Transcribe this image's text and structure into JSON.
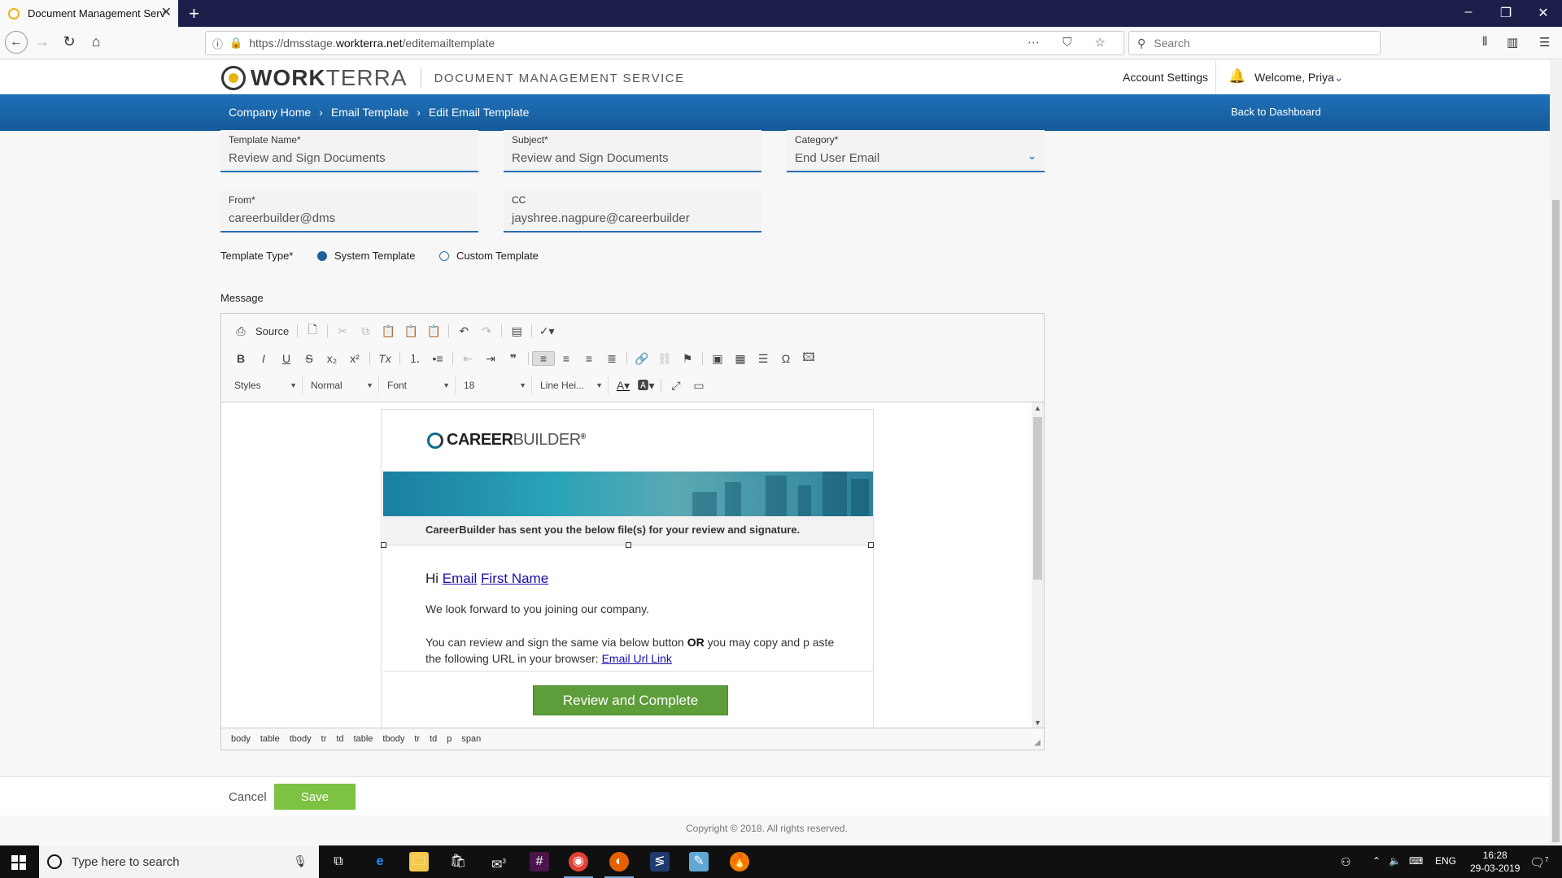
{
  "browser": {
    "tab_title": "Document Management Servic",
    "url_prefix": "https://dmsstage.",
    "url_host": "workterra.net",
    "url_path": "/editemailtemplate",
    "search_placeholder": "Search"
  },
  "header": {
    "brand_bold": "WORK",
    "brand_light": "TERRA",
    "service": "DOCUMENT MANAGEMENT SERVICE",
    "account_settings": "Account Settings",
    "welcome": "Welcome, Priya"
  },
  "breadcrumb": {
    "items": [
      "Company Home",
      "Email Template",
      "Edit Email Template"
    ],
    "back": "Back to Dashboard"
  },
  "form": {
    "template_name": {
      "label": "Template Name*",
      "value": "Review and Sign Documents"
    },
    "subject": {
      "label": "Subject*",
      "value": "Review and Sign Documents"
    },
    "category": {
      "label": "Category*",
      "value": "End User Email"
    },
    "from": {
      "label": "From*",
      "value": "careerbuilder@dms"
    },
    "cc": {
      "label": "CC",
      "value": "jayshree.nagpure@careerbuilder"
    },
    "template_type": {
      "label": "Template Type*",
      "options": [
        "System Template",
        "Custom Template"
      ],
      "selected": "System Template"
    },
    "message_label": "Message"
  },
  "editor": {
    "source_label": "Source",
    "combos": {
      "styles": "Styles",
      "format": "Normal",
      "font": "Font",
      "size": "18",
      "line_height": "Line Hei..."
    },
    "path": [
      "body",
      "table",
      "tbody",
      "tr",
      "td",
      "table",
      "tbody",
      "tr",
      "td",
      "p",
      "span"
    ]
  },
  "email": {
    "logo_bold": "CAREER",
    "logo_light": "BUILDER",
    "logo_mark": "®",
    "band_text": "CareerBuilder has sent you the below file(s) for your review and signature.",
    "greeting": "Hi",
    "greet_link1": "Email",
    "greet_link2": "First Name",
    "para1": "We look forward to you joining our company.",
    "para2_a": "You can review and sign the same via below button ",
    "para2_or": "OR",
    "para2_b": " you may copy and p aste the following URL in your browser: ",
    "para2_link": "Email Url Link",
    "cta": "Review and Complete"
  },
  "actions": {
    "cancel": "Cancel",
    "save": "Save"
  },
  "footer": {
    "copyright": "Copyright © 2018. All rights reserved."
  },
  "taskbar": {
    "search_placeholder": "Type here to search",
    "lang": "ENG",
    "time": "16:28",
    "date": "29-03-2019",
    "notif_count": "7",
    "mail_badge": "3"
  }
}
